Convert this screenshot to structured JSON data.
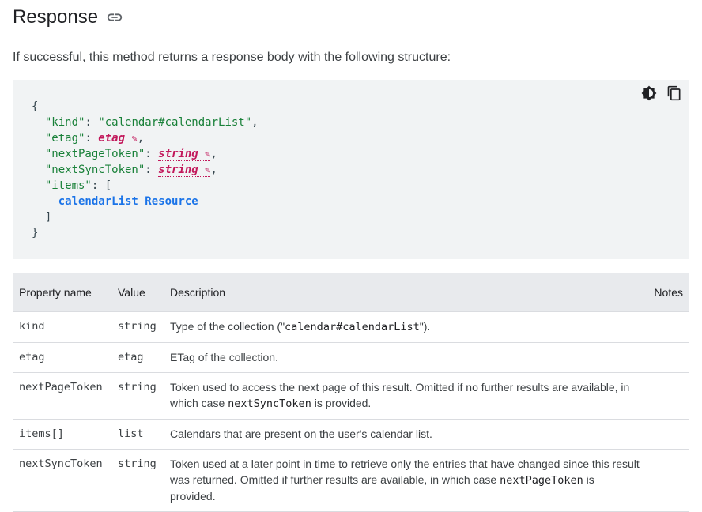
{
  "section": {
    "title": "Response",
    "intro": "If successful, this method returns a response body with the following structure:"
  },
  "code": {
    "open_brace": "{",
    "close_brace": "}",
    "line_kind_key": "\"kind\"",
    "line_kind_value": "\"calendar#calendarList\"",
    "line_etag_key": "\"etag\"",
    "line_etag_value": "etag",
    "line_next_page_key": "\"nextPageToken\"",
    "line_next_page_value": "string",
    "line_next_sync_key": "\"nextSyncToken\"",
    "line_next_sync_value": "string",
    "line_items_key": "\"items\"",
    "items_open": "[",
    "items_close": "]",
    "resource_link": "calendarList Resource",
    "theme_icon": "dark-mode-icon",
    "copy_icon": "copy-icon"
  },
  "table": {
    "headers": [
      "Property name",
      "Value",
      "Description",
      "Notes"
    ],
    "rows": [
      {
        "name": "kind",
        "value": "string",
        "desc_pre": "Type of the collection (\"",
        "desc_code": "calendar#calendarList",
        "desc_post": "\")."
      },
      {
        "name": "etag",
        "value": "etag",
        "desc_pre": "ETag of the collection."
      },
      {
        "name": "nextPageToken",
        "value": "string",
        "desc_pre": "Token used to access the next page of this result. Omitted if no further results are available, in which case ",
        "desc_code": "nextSyncToken",
        "desc_post": " is provided."
      },
      {
        "name": "items[]",
        "value": "list",
        "desc_pre": "Calendars that are present on the user's calendar list."
      },
      {
        "name": "nextSyncToken",
        "value": "string",
        "desc_pre": "Token used at a later point in time to retrieve only the entries that have changed since this result was returned. Omitted if further results are available, in which case ",
        "desc_code": "nextPageToken",
        "desc_post": " is provided."
      }
    ]
  }
}
